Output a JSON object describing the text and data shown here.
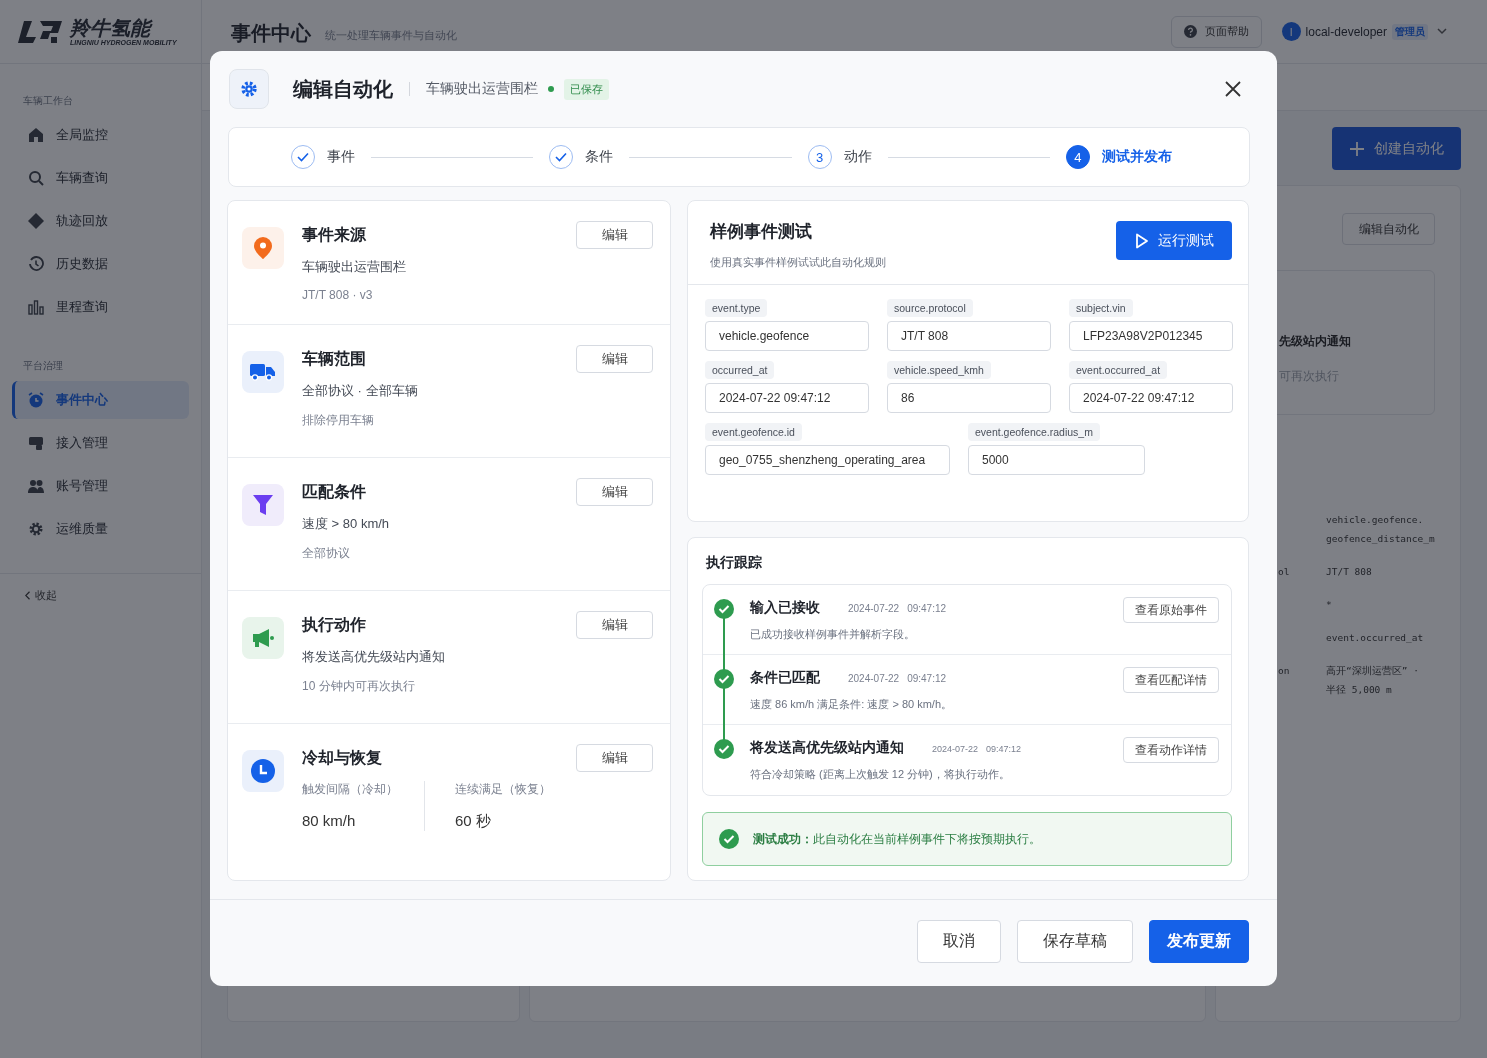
{
  "brand": {
    "name": "羚牛氢能",
    "tagline": "LINGNIU HYDROGEN MOBILITY"
  },
  "sidebar": {
    "sections": [
      {
        "label": "车辆工作台",
        "items": [
          {
            "label": "全局监控",
            "selected": false
          },
          {
            "label": "车辆查询",
            "selected": false
          },
          {
            "label": "轨迹回放",
            "selected": false
          },
          {
            "label": "历史数据",
            "selected": false
          },
          {
            "label": "里程查询",
            "selected": false
          }
        ]
      },
      {
        "label": "平台治理",
        "items": [
          {
            "label": "事件中心",
            "selected": true
          },
          {
            "label": "接入管理",
            "selected": false
          },
          {
            "label": "账号管理",
            "selected": false
          },
          {
            "label": "运维质量",
            "selected": false
          }
        ]
      }
    ],
    "collapse": "收起"
  },
  "header": {
    "title": "事件中心",
    "subtitle": "统一处理车辆事件与自动化",
    "help": "页面帮助",
    "user": {
      "initial": "l",
      "name": "local-developer",
      "role": "管理员"
    }
  },
  "background": {
    "create_button": "创建自动化",
    "edit_button": "编辑自动化",
    "card_lines": [
      "先级站内通知",
      "可再次执行"
    ],
    "rows": [
      {
        "label": "",
        "value": [
          "vehicle.geofence.",
          "geofence_distance_m"
        ]
      },
      {
        "label": "ol",
        "value": [
          "JT/T 808"
        ]
      },
      {
        "label": "",
        "value": [
          "*"
        ]
      },
      {
        "label": "",
        "value": [
          "event.occurred_at"
        ]
      },
      {
        "label": "on",
        "value": [
          "高开“深圳运营区” ·",
          "半径 5,000 m"
        ]
      }
    ]
  },
  "modal": {
    "title": "编辑自动化",
    "name": "车辆驶出运营围栏",
    "saved_tag": "已保存",
    "steps": [
      {
        "label": "事件",
        "done": true,
        "selected": false
      },
      {
        "label": "条件",
        "done": true,
        "selected": false
      },
      {
        "number": "3",
        "label": "动作",
        "done": false,
        "selected": false
      },
      {
        "number": "4",
        "label": "测试并发布",
        "done": false,
        "selected": true
      }
    ],
    "sections": [
      {
        "kind": "info",
        "title": "事件来源",
        "lines": [
          "车辆驶出运营围栏",
          "JT/T 808 · v3"
        ],
        "edit": "编辑"
      },
      {
        "kind": "info",
        "title": "车辆范围",
        "lines": [
          "全部协议 · 全部车辆",
          "排除停用车辆"
        ],
        "edit": "编辑"
      },
      {
        "kind": "info",
        "title": "匹配条件",
        "lines": [
          "速度 > 80 km/h",
          "全部协议"
        ],
        "edit": "编辑"
      },
      {
        "kind": "info",
        "title": "执行动作",
        "lines": [
          "将发送高优先级站内通知",
          "10 分钟内可再次执行"
        ],
        "edit": "编辑"
      },
      {
        "kind": "metrics",
        "title": "冷却与恢复",
        "metrics": [
          {
            "label": "触发间隔（冷却）",
            "value": "80 km/h"
          },
          {
            "label": "连续满足（恢复）",
            "value": "60 秒"
          }
        ],
        "edit": "编辑"
      }
    ],
    "test": {
      "title": "样例事件测试",
      "subtitle": "使用真实事件样例试试此自动化规则",
      "run_button": "运行测试",
      "field_rows": [
        [
          {
            "label": "event.type",
            "value": "vehicle.geofence"
          },
          {
            "label": "source.protocol",
            "value": "JT/T 808"
          },
          {
            "label": "subject.vin",
            "value": "LFP23A98V2P012345"
          }
        ],
        [
          {
            "label": "occurred_at",
            "value": "2024-07-22 09:47:12"
          },
          {
            "label": "vehicle.speed_kmh",
            "value": "86"
          },
          {
            "label": "event.occurred_at",
            "value": "2024-07-22 09:47:12"
          }
        ],
        [
          {
            "label": "event.geofence.id",
            "value": "geo_0755_shenzheng_operating_area"
          },
          {
            "label": "event.geofence.radius_m",
            "value": "5000"
          }
        ]
      ]
    },
    "trace": {
      "title": "执行跟踪",
      "steps": [
        {
          "done": true,
          "title": "输入已接收",
          "date": "2024-07-22",
          "time": "09:47:12",
          "description": "已成功接收样例事件并解析字段。",
          "button": "查看原始事件"
        },
        {
          "done": true,
          "title": "条件已匹配",
          "date": "2024-07-22",
          "time": "09:47:12",
          "description": "速度 86 km/h 满足条件: 速度 > 80 km/h。",
          "button": "查看匹配详情"
        },
        {
          "done": true,
          "title": "将发送高优先级站内通知",
          "date": "2024-07-22",
          "time": "09:47:12",
          "description": "符合冷却策略 (距离上次触发 12 分钟)，将执行动作。",
          "button": "查看动作详情"
        }
      ],
      "result": {
        "success": true,
        "label": "测试成功：",
        "text": "此自动化在当前样例事件下将按预期执行。"
      }
    },
    "footer": [
      {
        "label": "取消",
        "kind": "secondary"
      },
      {
        "label": "保存草稿",
        "kind": "secondary"
      },
      {
        "label": "发布更新",
        "kind": "primary"
      }
    ]
  }
}
